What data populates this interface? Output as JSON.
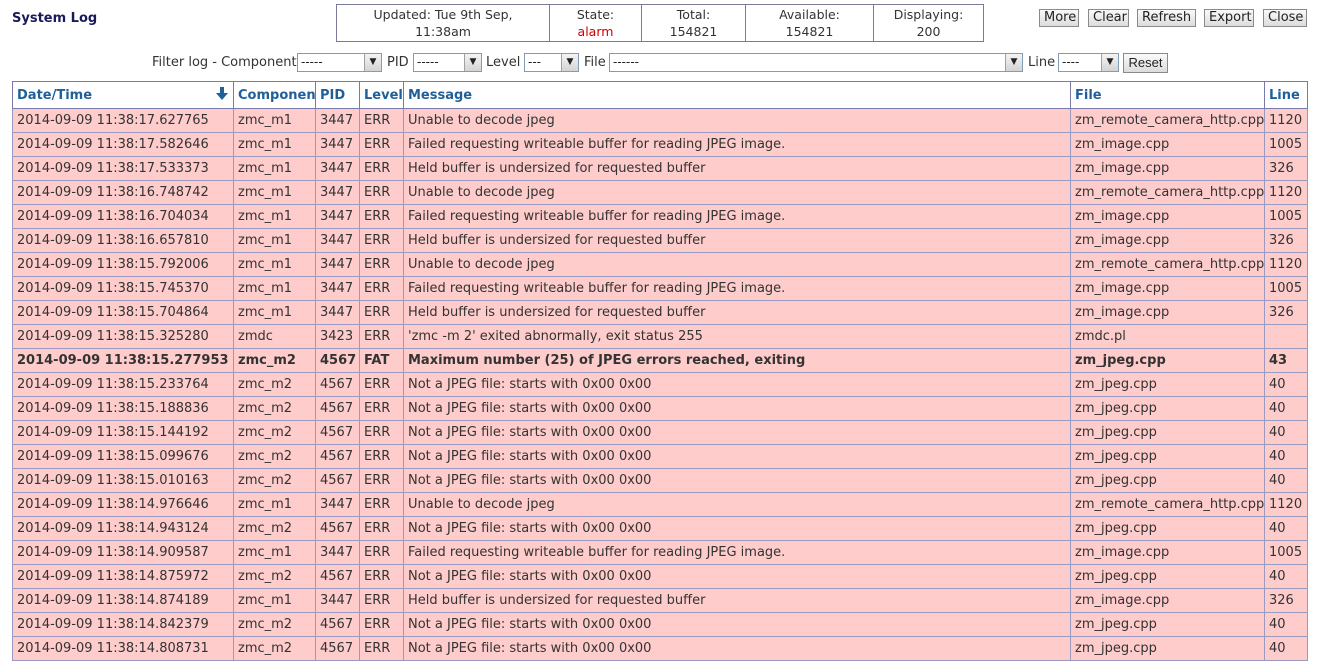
{
  "page": {
    "title": "System Log"
  },
  "status": {
    "updated_label": "Updated: Tue 9th Sep,",
    "updated_time": "11:38am",
    "state_label": "State:",
    "state_value": "alarm",
    "total_label": "Total:",
    "total_value": "154821",
    "available_label": "Available:",
    "available_value": "154821",
    "displaying_label": "Displaying:",
    "displaying_value": "200"
  },
  "toolbar": {
    "more": "More",
    "clear": "Clear",
    "refresh": "Refresh",
    "export": "Export",
    "close": "Close"
  },
  "filter": {
    "label": "Filter log - Component",
    "component_value": "-----",
    "pid_label": "PID",
    "pid_value": "-----",
    "level_label": "Level",
    "level_value": "---",
    "file_label": "File",
    "file_value": "------",
    "line_label": "Line",
    "line_value": "----",
    "reset": "Reset"
  },
  "table": {
    "headers": {
      "datetime": "Date/Time",
      "component": "Component",
      "pid": "PID",
      "level": "Level",
      "message": "Message",
      "file": "File",
      "line": "Line"
    },
    "rows": [
      {
        "datetime": "2014-09-09 11:38:17.627765",
        "component": "zmc_m1",
        "pid": "3447",
        "level": "ERR",
        "message": "Unable to decode jpeg",
        "file": "zm_remote_camera_http.cpp",
        "line": "1120"
      },
      {
        "datetime": "2014-09-09 11:38:17.582646",
        "component": "zmc_m1",
        "pid": "3447",
        "level": "ERR",
        "message": "Failed requesting writeable buffer for reading JPEG image.",
        "file": "zm_image.cpp",
        "line": "1005"
      },
      {
        "datetime": "2014-09-09 11:38:17.533373",
        "component": "zmc_m1",
        "pid": "3447",
        "level": "ERR",
        "message": "Held buffer is undersized for requested buffer",
        "file": "zm_image.cpp",
        "line": "326"
      },
      {
        "datetime": "2014-09-09 11:38:16.748742",
        "component": "zmc_m1",
        "pid": "3447",
        "level": "ERR",
        "message": "Unable to decode jpeg",
        "file": "zm_remote_camera_http.cpp",
        "line": "1120"
      },
      {
        "datetime": "2014-09-09 11:38:16.704034",
        "component": "zmc_m1",
        "pid": "3447",
        "level": "ERR",
        "message": "Failed requesting writeable buffer for reading JPEG image.",
        "file": "zm_image.cpp",
        "line": "1005"
      },
      {
        "datetime": "2014-09-09 11:38:16.657810",
        "component": "zmc_m1",
        "pid": "3447",
        "level": "ERR",
        "message": "Held buffer is undersized for requested buffer",
        "file": "zm_image.cpp",
        "line": "326"
      },
      {
        "datetime": "2014-09-09 11:38:15.792006",
        "component": "zmc_m1",
        "pid": "3447",
        "level": "ERR",
        "message": "Unable to decode jpeg",
        "file": "zm_remote_camera_http.cpp",
        "line": "1120"
      },
      {
        "datetime": "2014-09-09 11:38:15.745370",
        "component": "zmc_m1",
        "pid": "3447",
        "level": "ERR",
        "message": "Failed requesting writeable buffer for reading JPEG image.",
        "file": "zm_image.cpp",
        "line": "1005"
      },
      {
        "datetime": "2014-09-09 11:38:15.704864",
        "component": "zmc_m1",
        "pid": "3447",
        "level": "ERR",
        "message": "Held buffer is undersized for requested buffer",
        "file": "zm_image.cpp",
        "line": "326"
      },
      {
        "datetime": "2014-09-09 11:38:15.325280",
        "component": "zmdc",
        "pid": "3423",
        "level": "ERR",
        "message": "'zmc -m 2' exited abnormally, exit status 255",
        "file": "zmdc.pl",
        "line": ""
      },
      {
        "datetime": "2014-09-09 11:38:15.277953",
        "component": "zmc_m2",
        "pid": "4567",
        "level": "FAT",
        "message": "Maximum number (25) of JPEG errors reached, exiting",
        "file": "zm_jpeg.cpp",
        "line": "43"
      },
      {
        "datetime": "2014-09-09 11:38:15.233764",
        "component": "zmc_m2",
        "pid": "4567",
        "level": "ERR",
        "message": "Not a JPEG file: starts with 0x00 0x00",
        "file": "zm_jpeg.cpp",
        "line": "40"
      },
      {
        "datetime": "2014-09-09 11:38:15.188836",
        "component": "zmc_m2",
        "pid": "4567",
        "level": "ERR",
        "message": "Not a JPEG file: starts with 0x00 0x00",
        "file": "zm_jpeg.cpp",
        "line": "40"
      },
      {
        "datetime": "2014-09-09 11:38:15.144192",
        "component": "zmc_m2",
        "pid": "4567",
        "level": "ERR",
        "message": "Not a JPEG file: starts with 0x00 0x00",
        "file": "zm_jpeg.cpp",
        "line": "40"
      },
      {
        "datetime": "2014-09-09 11:38:15.099676",
        "component": "zmc_m2",
        "pid": "4567",
        "level": "ERR",
        "message": "Not a JPEG file: starts with 0x00 0x00",
        "file": "zm_jpeg.cpp",
        "line": "40"
      },
      {
        "datetime": "2014-09-09 11:38:15.010163",
        "component": "zmc_m2",
        "pid": "4567",
        "level": "ERR",
        "message": "Not a JPEG file: starts with 0x00 0x00",
        "file": "zm_jpeg.cpp",
        "line": "40"
      },
      {
        "datetime": "2014-09-09 11:38:14.976646",
        "component": "zmc_m1",
        "pid": "3447",
        "level": "ERR",
        "message": "Unable to decode jpeg",
        "file": "zm_remote_camera_http.cpp",
        "line": "1120"
      },
      {
        "datetime": "2014-09-09 11:38:14.943124",
        "component": "zmc_m2",
        "pid": "4567",
        "level": "ERR",
        "message": "Not a JPEG file: starts with 0x00 0x00",
        "file": "zm_jpeg.cpp",
        "line": "40"
      },
      {
        "datetime": "2014-09-09 11:38:14.909587",
        "component": "zmc_m1",
        "pid": "3447",
        "level": "ERR",
        "message": "Failed requesting writeable buffer for reading JPEG image.",
        "file": "zm_image.cpp",
        "line": "1005"
      },
      {
        "datetime": "2014-09-09 11:38:14.875972",
        "component": "zmc_m2",
        "pid": "4567",
        "level": "ERR",
        "message": "Not a JPEG file: starts with 0x00 0x00",
        "file": "zm_jpeg.cpp",
        "line": "40"
      },
      {
        "datetime": "2014-09-09 11:38:14.874189",
        "component": "zmc_m1",
        "pid": "3447",
        "level": "ERR",
        "message": "Held buffer is undersized for requested buffer",
        "file": "zm_image.cpp",
        "line": "326"
      },
      {
        "datetime": "2014-09-09 11:38:14.842379",
        "component": "zmc_m2",
        "pid": "4567",
        "level": "ERR",
        "message": "Not a JPEG file: starts with 0x00 0x00",
        "file": "zm_jpeg.cpp",
        "line": "40"
      },
      {
        "datetime": "2014-09-09 11:38:14.808731",
        "component": "zmc_m2",
        "pid": "4567",
        "level": "ERR",
        "message": "Not a JPEG file: starts with 0x00 0x00",
        "file": "zm_jpeg.cpp",
        "line": "40"
      }
    ]
  },
  "colors": {
    "row_bg": "#ffcccc",
    "header_text": "#1f5f9a",
    "alarm": "#cc0000"
  }
}
